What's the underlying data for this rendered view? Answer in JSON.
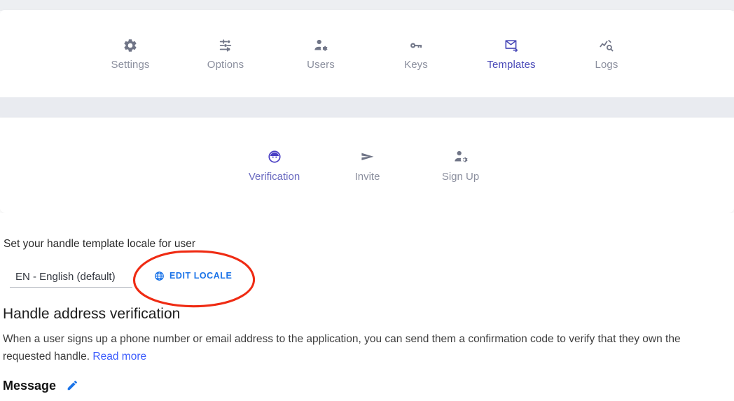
{
  "primary_nav": {
    "items": [
      {
        "label": "Settings",
        "icon": "gear-icon",
        "active": false
      },
      {
        "label": "Options",
        "icon": "tune-sliders-icon",
        "active": false
      },
      {
        "label": "Users",
        "icon": "manage-accounts-icon",
        "active": false
      },
      {
        "label": "Keys",
        "icon": "key-icon",
        "active": false
      },
      {
        "label": "Templates",
        "icon": "mail-forward-icon",
        "active": true
      },
      {
        "label": "Logs",
        "icon": "query-stats-icon",
        "active": false
      }
    ],
    "active_label": "Templates",
    "active_color": "#4a4ab8",
    "inactive_color": "#8b8f9e"
  },
  "sub_nav": {
    "items": [
      {
        "label": "Verification",
        "icon": "account-face-circle-icon",
        "active": true
      },
      {
        "label": "Invite",
        "icon": "send-icon",
        "active": false
      },
      {
        "label": "Sign Up",
        "icon": "manage-accounts-icon",
        "active": false
      }
    ],
    "active_label": "Verification",
    "active_color": "#4a3fc4",
    "inactive_color": "#8b8f9e"
  },
  "locale": {
    "caption": "Set your handle template locale for user",
    "selected": "EN - English (default)",
    "options": [
      "EN - English (default)"
    ],
    "edit_button_label": "EDIT LOCALE",
    "edit_button_icon": "globe-icon",
    "edit_button_color": "#1a73e8"
  },
  "annotation": {
    "shape": "ellipse",
    "color": "#ef2b13",
    "target": "EDIT LOCALE"
  },
  "section": {
    "title": "Handle address verification",
    "body_text": "When a user signs up a phone number or email address to the application, you can send them a confirmation code to verify that they own the requested handle.",
    "read_more_label": "Read more",
    "read_more_color": "#3b5bfd"
  },
  "message": {
    "title": "Message",
    "edit_icon": "pencil-edit-icon",
    "edit_icon_color": "#1a73e8"
  },
  "colors": {
    "page_background": "#ffffff",
    "strip_background": "#edeff2",
    "band_background": "#e9ebf0",
    "card_background": "#ffffff"
  }
}
